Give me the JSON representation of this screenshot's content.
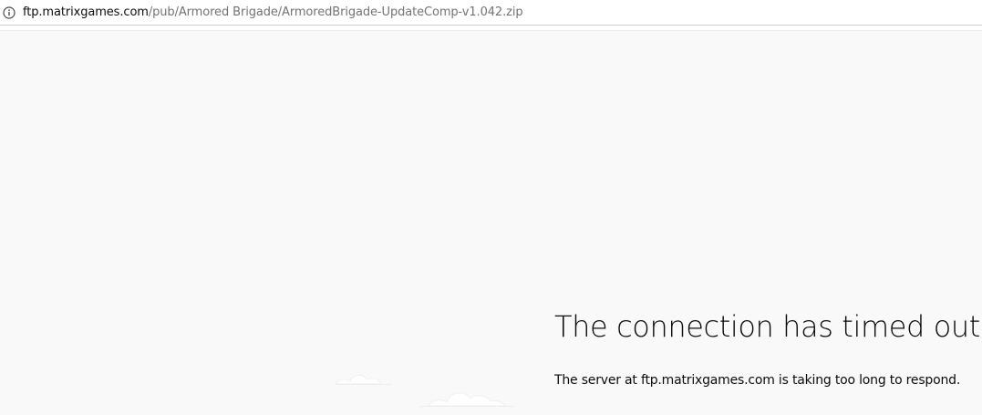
{
  "browser": {
    "url_domain": "ftp.matrixgames.com",
    "url_path": "/pub/Armored Brigade/ArmoredBrigade-UpdateComp-v1.042.zip",
    "site_info_icon": "info-circle-icon"
  },
  "error_page": {
    "title": "The connection has timed out",
    "description": "The server at ftp.matrixgames.com is taking too long to respond.",
    "illustration": "clouds-icon"
  }
}
